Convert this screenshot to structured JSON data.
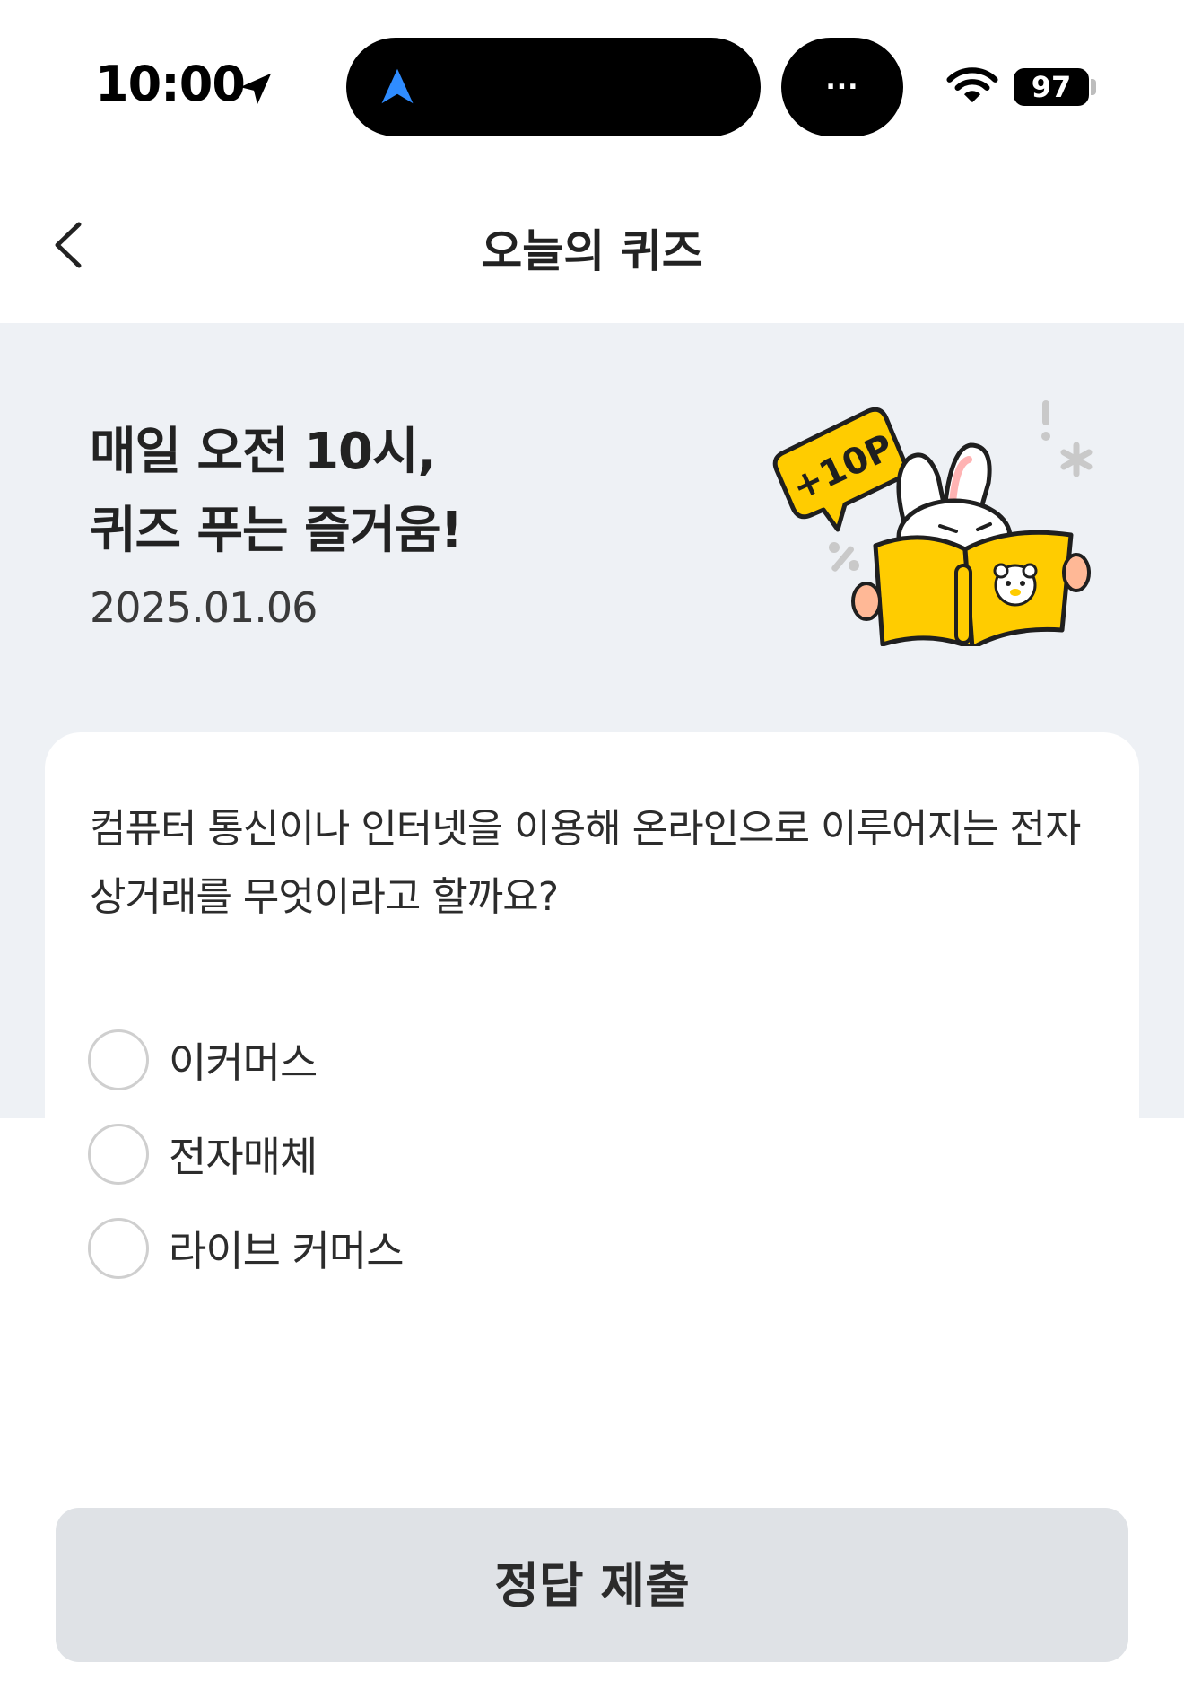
{
  "status_bar": {
    "time": "10:00",
    "island_dots": "...",
    "battery": "97",
    "icons": [
      "location-arrow-icon",
      "navigation-icon",
      "wifi-icon",
      "battery-icon"
    ]
  },
  "header": {
    "title": "오늘의 퀴즈",
    "back_icon": "chevron-left-icon"
  },
  "hero": {
    "title_line1": "매일 오전 10시,",
    "title_line2": "퀴즈 푸는 즐거움!",
    "date": "2025.01.06",
    "points_badge": "+10P"
  },
  "quiz": {
    "question": "컴퓨터 통신이나 인터넷을 이용해 온라인으로 이루어지는 전자 상거래를 무엇이라고 할까요?",
    "options": [
      {
        "label": "이커머스",
        "selected": false
      },
      {
        "label": "전자매체",
        "selected": false
      },
      {
        "label": "라이브 커머스",
        "selected": false
      }
    ]
  },
  "submit": {
    "label": "정답 제출",
    "enabled": false
  },
  "colors": {
    "hero_bg": "#eef1f5",
    "accent_yellow": "#ffcc00",
    "button_disabled_bg": "#dfe2e6",
    "radio_border": "#cfcfcf",
    "nav_blue": "#2f8cff"
  }
}
